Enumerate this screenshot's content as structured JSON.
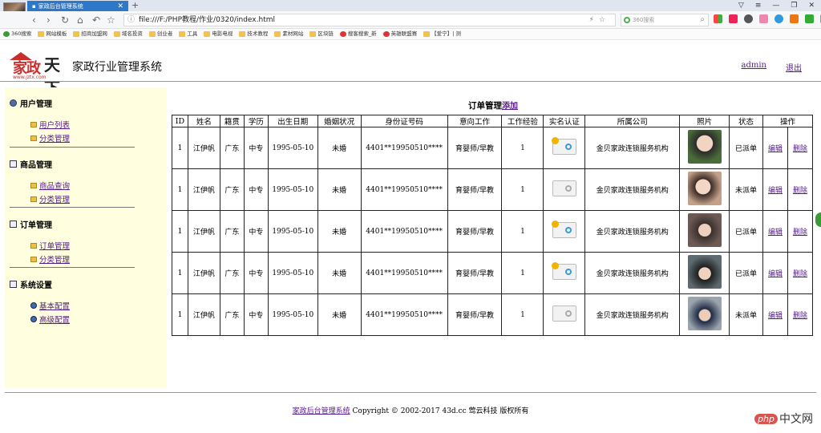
{
  "browser": {
    "tab_title": "家政后台管理系统",
    "url": "file:///F:/PHP教程/作业/0320/index.html",
    "search_placeholder": "360搜索",
    "bookmarks": [
      "360搜索",
      "网站模板",
      "招商加盟网",
      "域名投资",
      "创业者",
      "工具",
      "电影电视",
      "技术教程",
      "素材网站",
      "区块链",
      "搜客搜索_新",
      "英雄联盟赛",
      "【爱宁】| 测"
    ]
  },
  "header": {
    "logo_text": "家政",
    "logo_text2": "天下",
    "logo_url": "www.jztx.com",
    "system_title": "家政行业管理系统",
    "admin_link": "admin",
    "logout_link": "退出"
  },
  "sidebar": {
    "sections": [
      {
        "title": "用户管理",
        "items": [
          "用户列表",
          "分类管理"
        ]
      },
      {
        "title": "商品管理",
        "items": [
          "商品查询",
          "分类管理"
        ]
      },
      {
        "title": "订单管理",
        "items": [
          "订单管理",
          "分类管理"
        ]
      },
      {
        "title": "系统设置",
        "items": [
          "基本配置",
          "高级配置"
        ]
      }
    ]
  },
  "main": {
    "title": "订单管理",
    "add_link": "添加",
    "columns": [
      "ID",
      "姓名",
      "籍贯",
      "学历",
      "出生日期",
      "婚姻状况",
      "身份证号码",
      "意向工作",
      "工作经验",
      "实名认证",
      "所属公司",
      "照片",
      "状态",
      "操作"
    ],
    "rows": [
      {
        "id": "1",
        "name": "江伊帆",
        "origin": "广东",
        "edu": "中专",
        "birth": "1995-05-10",
        "marital": "未婚",
        "idno": "4401**19950510****",
        "job": "育婴师/早教",
        "exp": "1",
        "verified": true,
        "company": "金贝家政连锁服务机构",
        "status": "已派单",
        "edit": "编辑",
        "del": "删除"
      },
      {
        "id": "1",
        "name": "江伊帆",
        "origin": "广东",
        "edu": "中专",
        "birth": "1995-05-10",
        "marital": "未婚",
        "idno": "4401**19950510****",
        "job": "育婴师/早教",
        "exp": "1",
        "verified": false,
        "company": "金贝家政连锁服务机构",
        "status": "未派单",
        "edit": "编辑",
        "del": "删除"
      },
      {
        "id": "1",
        "name": "江伊帆",
        "origin": "广东",
        "edu": "中专",
        "birth": "1995-05-10",
        "marital": "未婚",
        "idno": "4401**19950510****",
        "job": "育婴师/早教",
        "exp": "1",
        "verified": true,
        "company": "金贝家政连锁服务机构",
        "status": "已派单",
        "edit": "编辑",
        "del": "删除"
      },
      {
        "id": "1",
        "name": "江伊帆",
        "origin": "广东",
        "edu": "中专",
        "birth": "1995-05-10",
        "marital": "未婚",
        "idno": "4401**19950510****",
        "job": "育婴师/早教",
        "exp": "1",
        "verified": true,
        "company": "金贝家政连锁服务机构",
        "status": "已派单",
        "edit": "编辑",
        "del": "删除"
      },
      {
        "id": "1",
        "name": "江伊帆",
        "origin": "广东",
        "edu": "中专",
        "birth": "1995-05-10",
        "marital": "未婚",
        "idno": "4401**19950510****",
        "job": "育婴师/早教",
        "exp": "1",
        "verified": false,
        "company": "金贝家政连锁服务机构",
        "status": "未派单",
        "edit": "编辑",
        "del": "删除"
      }
    ]
  },
  "footer": {
    "link": "家政后台管理系统",
    "text": "Copyright © 2002-2017 43d.cc 莺云科技 版权所有"
  },
  "watermark": {
    "brand": "php",
    "text": "中文网"
  }
}
